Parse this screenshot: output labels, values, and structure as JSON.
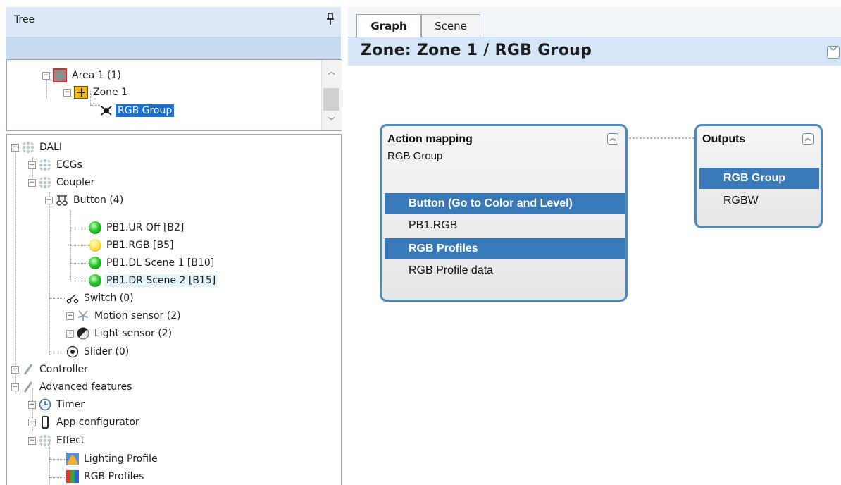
{
  "tree_panel": {
    "title": "Tree",
    "top_tree": [
      {
        "label": "Area 1 (1)",
        "icon": "area-icon"
      },
      {
        "label": "Zone 1",
        "icon": "zone-icon"
      },
      {
        "label": "RGB Group",
        "icon": "rgb-group-icon",
        "selected": true
      }
    ],
    "main_tree": [
      {
        "label": "DALI",
        "icon": "dali-icon"
      },
      {
        "label": "ECGs",
        "icon": "dali-icon"
      },
      {
        "label": "Coupler",
        "icon": "dali-icon"
      },
      {
        "label": "Button (4)",
        "icon": "button-icon"
      },
      {
        "label": "PB1.UR Off [B2]",
        "icon": "green-led-icon"
      },
      {
        "label": "PB1.RGB [B5]",
        "icon": "yellow-led-icon"
      },
      {
        "label": "PB1.DL Scene 1 [B10]",
        "icon": "green-led-icon"
      },
      {
        "label": "PB1.DR Scene 2 [B15]",
        "icon": "green-led-icon",
        "highlighted": true
      },
      {
        "label": "Switch (0)",
        "icon": "switch-icon"
      },
      {
        "label": "Motion sensor (2)",
        "icon": "motion-sensor-icon"
      },
      {
        "label": "Light sensor (2)",
        "icon": "light-sensor-icon"
      },
      {
        "label": "Slider (0)",
        "icon": "slider-icon"
      },
      {
        "label": "Controller",
        "icon": "controller-icon"
      },
      {
        "label": "Advanced features",
        "icon": "controller-icon"
      },
      {
        "label": "Timer",
        "icon": "clock-icon"
      },
      {
        "label": "App configurator",
        "icon": "phone-icon"
      },
      {
        "label": "Effect",
        "icon": "effect-icon"
      },
      {
        "label": "Lighting Profile",
        "icon": "lighting-profile-icon"
      },
      {
        "label": "RGB Profiles",
        "icon": "rgb-profiles-icon"
      }
    ]
  },
  "tabs": [
    {
      "label": "Graph",
      "active": true
    },
    {
      "label": "Scene",
      "active": false
    }
  ],
  "zone_header": {
    "title": "Zone: Zone 1 / RGB Group"
  },
  "action_card": {
    "title": "Action mapping",
    "subtitle": "RGB Group",
    "rows": [
      "Button (Go to Color and Level)",
      "PB1.RGB",
      "RGB Profiles",
      "RGB Profile data"
    ]
  },
  "outputs_card": {
    "title": "Outputs",
    "rows": [
      "RGB Group",
      "RGBW"
    ]
  },
  "colors": {
    "selection": "#1b6fd1",
    "card_border": "#4b89c0",
    "row_highlight": "#3a79b8",
    "header_bg": "#d4e5f7"
  }
}
